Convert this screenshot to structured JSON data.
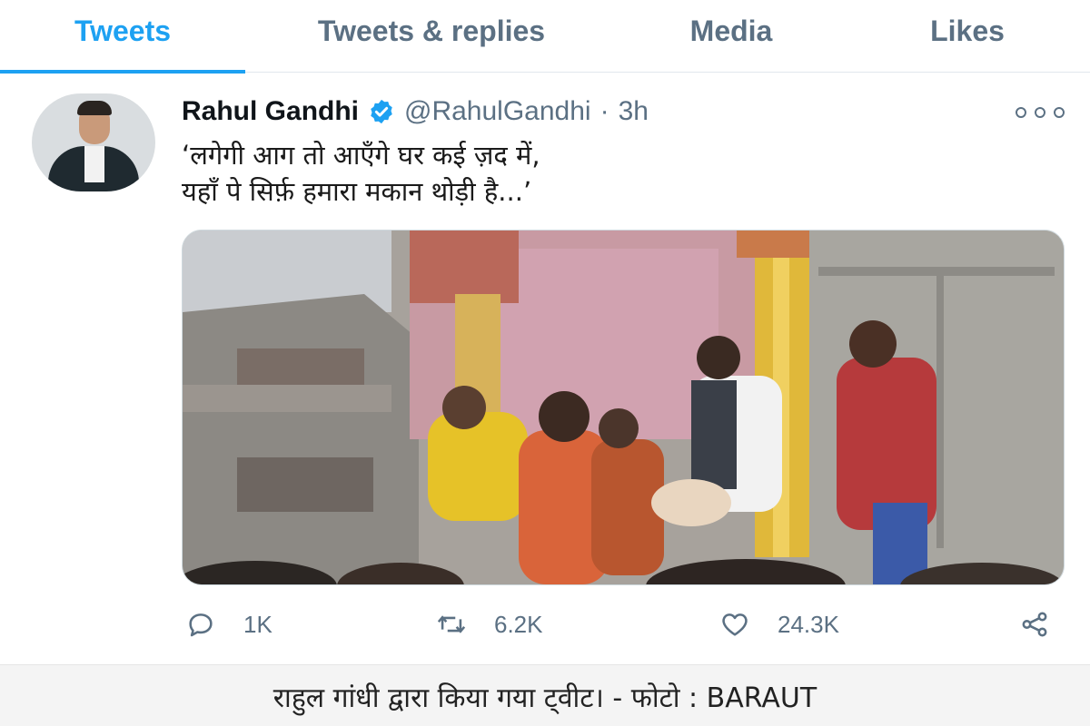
{
  "tabs": [
    {
      "label": "Tweets",
      "active": true
    },
    {
      "label": "Tweets & replies",
      "active": false
    },
    {
      "label": "Media",
      "active": false
    },
    {
      "label": "Likes",
      "active": false
    }
  ],
  "tweet": {
    "author_name": "Rahul Gandhi",
    "verified": true,
    "handle": "@RahulGandhi",
    "separator": "·",
    "time": "3h",
    "text_lines": [
      "‘लगेगी आग तो आएँगे घर कई ज़द में,",
      "यहाँ पे सिर्फ़ हमारा मकान थोड़ी है...’"
    ],
    "media_description_icon": "video-thumbnail",
    "actions": {
      "replies": "1K",
      "retweets": "6.2K",
      "likes": "24.3K"
    }
  },
  "caption": "राहुल गांधी द्वारा किया गया ट्वीट। - फोटो : BARAUT",
  "colors": {
    "accent": "#1da1f2",
    "secondary_text": "#5b7083",
    "border": "#e1e8ed"
  },
  "icons": {
    "verified": "verified-badge-icon",
    "more": "more-icon",
    "reply": "reply-icon",
    "retweet": "retweet-icon",
    "like": "heart-icon",
    "share": "share-icon"
  }
}
